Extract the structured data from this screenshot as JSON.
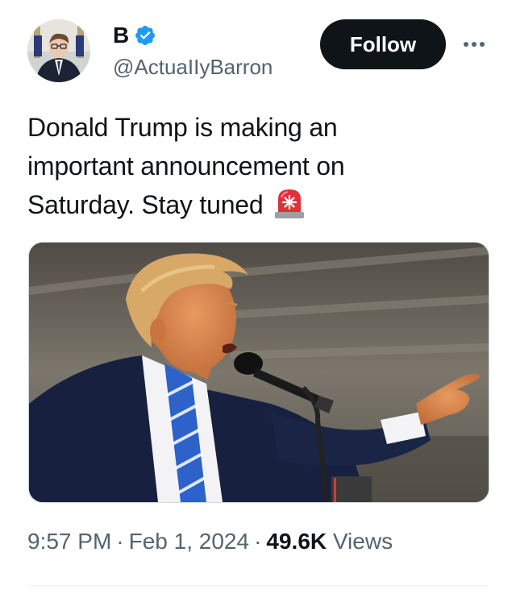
{
  "author": {
    "display_name": "B",
    "handle": "@ActuaIIyBarron",
    "verified": true
  },
  "actions": {
    "follow_label": "Follow"
  },
  "icons": {
    "more": "more-horizontal-icon",
    "verified": "verified-badge-icon",
    "siren": "police-siren-emoji"
  },
  "tweet": {
    "text_line1": "Donald Trump is making an",
    "text_line2": "important announcement on",
    "text_line3": "Saturday. Stay tuned",
    "emoji": "🚨"
  },
  "meta": {
    "time": "9:57 PM",
    "date": "Feb 1, 2024",
    "views_count": "49.6K",
    "views_label": "Views",
    "separator": "·"
  },
  "colors": {
    "text_primary": "#0f1419",
    "text_secondary": "#536471",
    "verified_blue": "#1d9bf0",
    "follow_bg": "#0f1419",
    "follow_text": "#ffffff"
  }
}
